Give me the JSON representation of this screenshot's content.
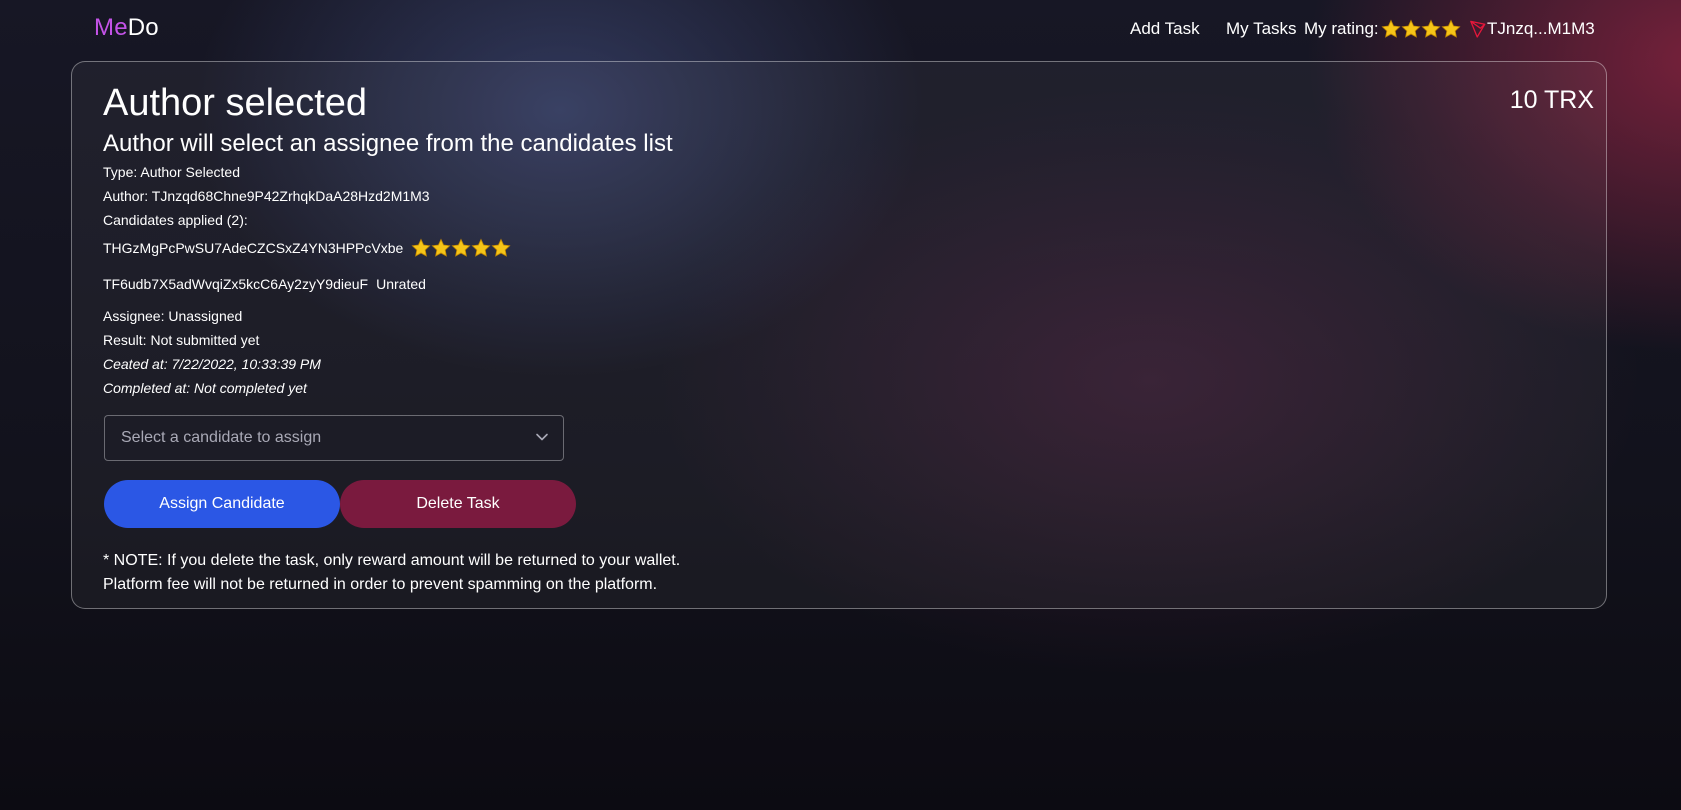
{
  "brand": {
    "part1": "Me",
    "part2": "Do",
    "accent_color": "#c453e8"
  },
  "nav": {
    "add_task": "Add Task",
    "my_tasks": "My Tasks",
    "rating_label": "My rating:",
    "rating_stars": 4,
    "wallet_icon": "tron-icon",
    "wallet_short": "TJnzq...M1M3"
  },
  "task": {
    "reward": "10 TRX",
    "title": "Author selected",
    "subtitle": "Author will select an assignee from the candidates list",
    "type": "Type: Author Selected",
    "author": "Author: TJnzqd68Chne9P42ZrhqkDaA28Hzd2M1M3",
    "candidates_heading": "Candidates applied (2):",
    "candidates": [
      {
        "address": "THGzMgPcPwSU7AdeCZCSxZ4YN3HPPcVxbe",
        "stars": 5,
        "status": ""
      },
      {
        "address": "TF6udb7X5adWvqiZx5kcC6Ay2zyY9dieuF",
        "stars": 0,
        "status": "Unrated"
      }
    ],
    "assignee": "Assignee: Unassigned",
    "result": "Result: Not submitted yet",
    "created_at": "Ceated at: 7/22/2022, 10:33:39 PM",
    "completed_at": "Completed at: Not completed yet"
  },
  "form": {
    "select_placeholder": "Select a candidate to assign",
    "assign_button": "Assign Candidate",
    "delete_button": "Delete Task"
  },
  "note": {
    "line1": "* NOTE: If you delete the task, only reward amount will be returned to your wallet.",
    "line2": "Platform fee will not be returned in order to prevent spamming on the platform."
  },
  "colors": {
    "assign_button": "#2b57e5",
    "delete_button": "#7a1a3e",
    "star": "#f5c518",
    "tron": "#e5173b"
  }
}
